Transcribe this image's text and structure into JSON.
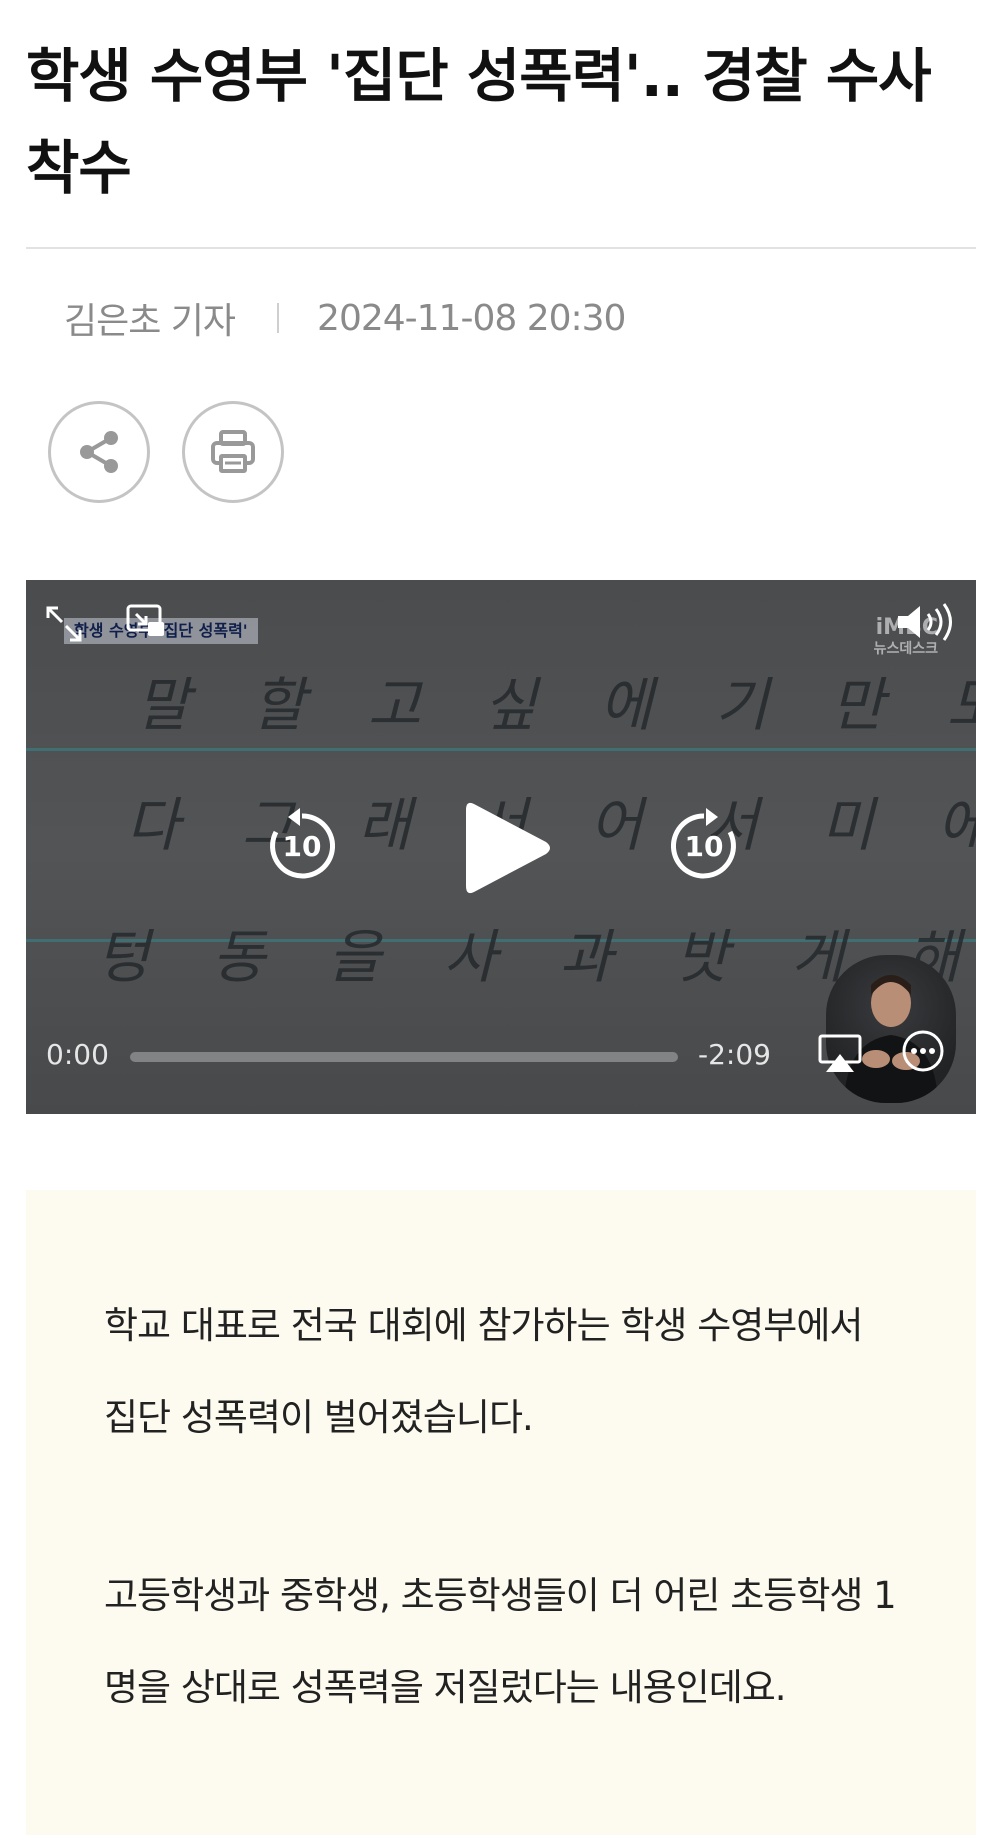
{
  "article": {
    "headline": "학생 수영부 '집단 성폭력'.. 경찰 수사 착수",
    "reporter": "김은초 기자",
    "datetime": "2024-11-08 20:30"
  },
  "actions": {
    "share_icon": "share-icon",
    "print_icon": "printer-icon"
  },
  "video": {
    "caption_tag": "학생 수영부 '집단 성폭력'",
    "logo_top": "iMBC",
    "logo_bottom": "뉴스데스크",
    "handwriting_line1": "말 할 고 싶 에 기 만 도 저 디 봉",
    "handwriting_line2": "다 그 래 서 어 서 미 에 게 말 합",
    "handwriting_line3": "텅 동 을 사 과 밧 게 해 주 세 요",
    "skip_back_label": "10",
    "skip_forward_label": "10",
    "current_time": "0:00",
    "remaining_time": "-2:09",
    "progress": 0.0
  },
  "summary": {
    "paragraph1": "학교 대표로 전국 대회에 참가하는 학생 수영부에서 집단 성폭력이 벌어졌습니다.",
    "paragraph2": "고등학생과 중학생, 초등학생들이 더 어린 초등학생 1명을 상대로 성폭력을 저질렀다는 내용인데요."
  }
}
